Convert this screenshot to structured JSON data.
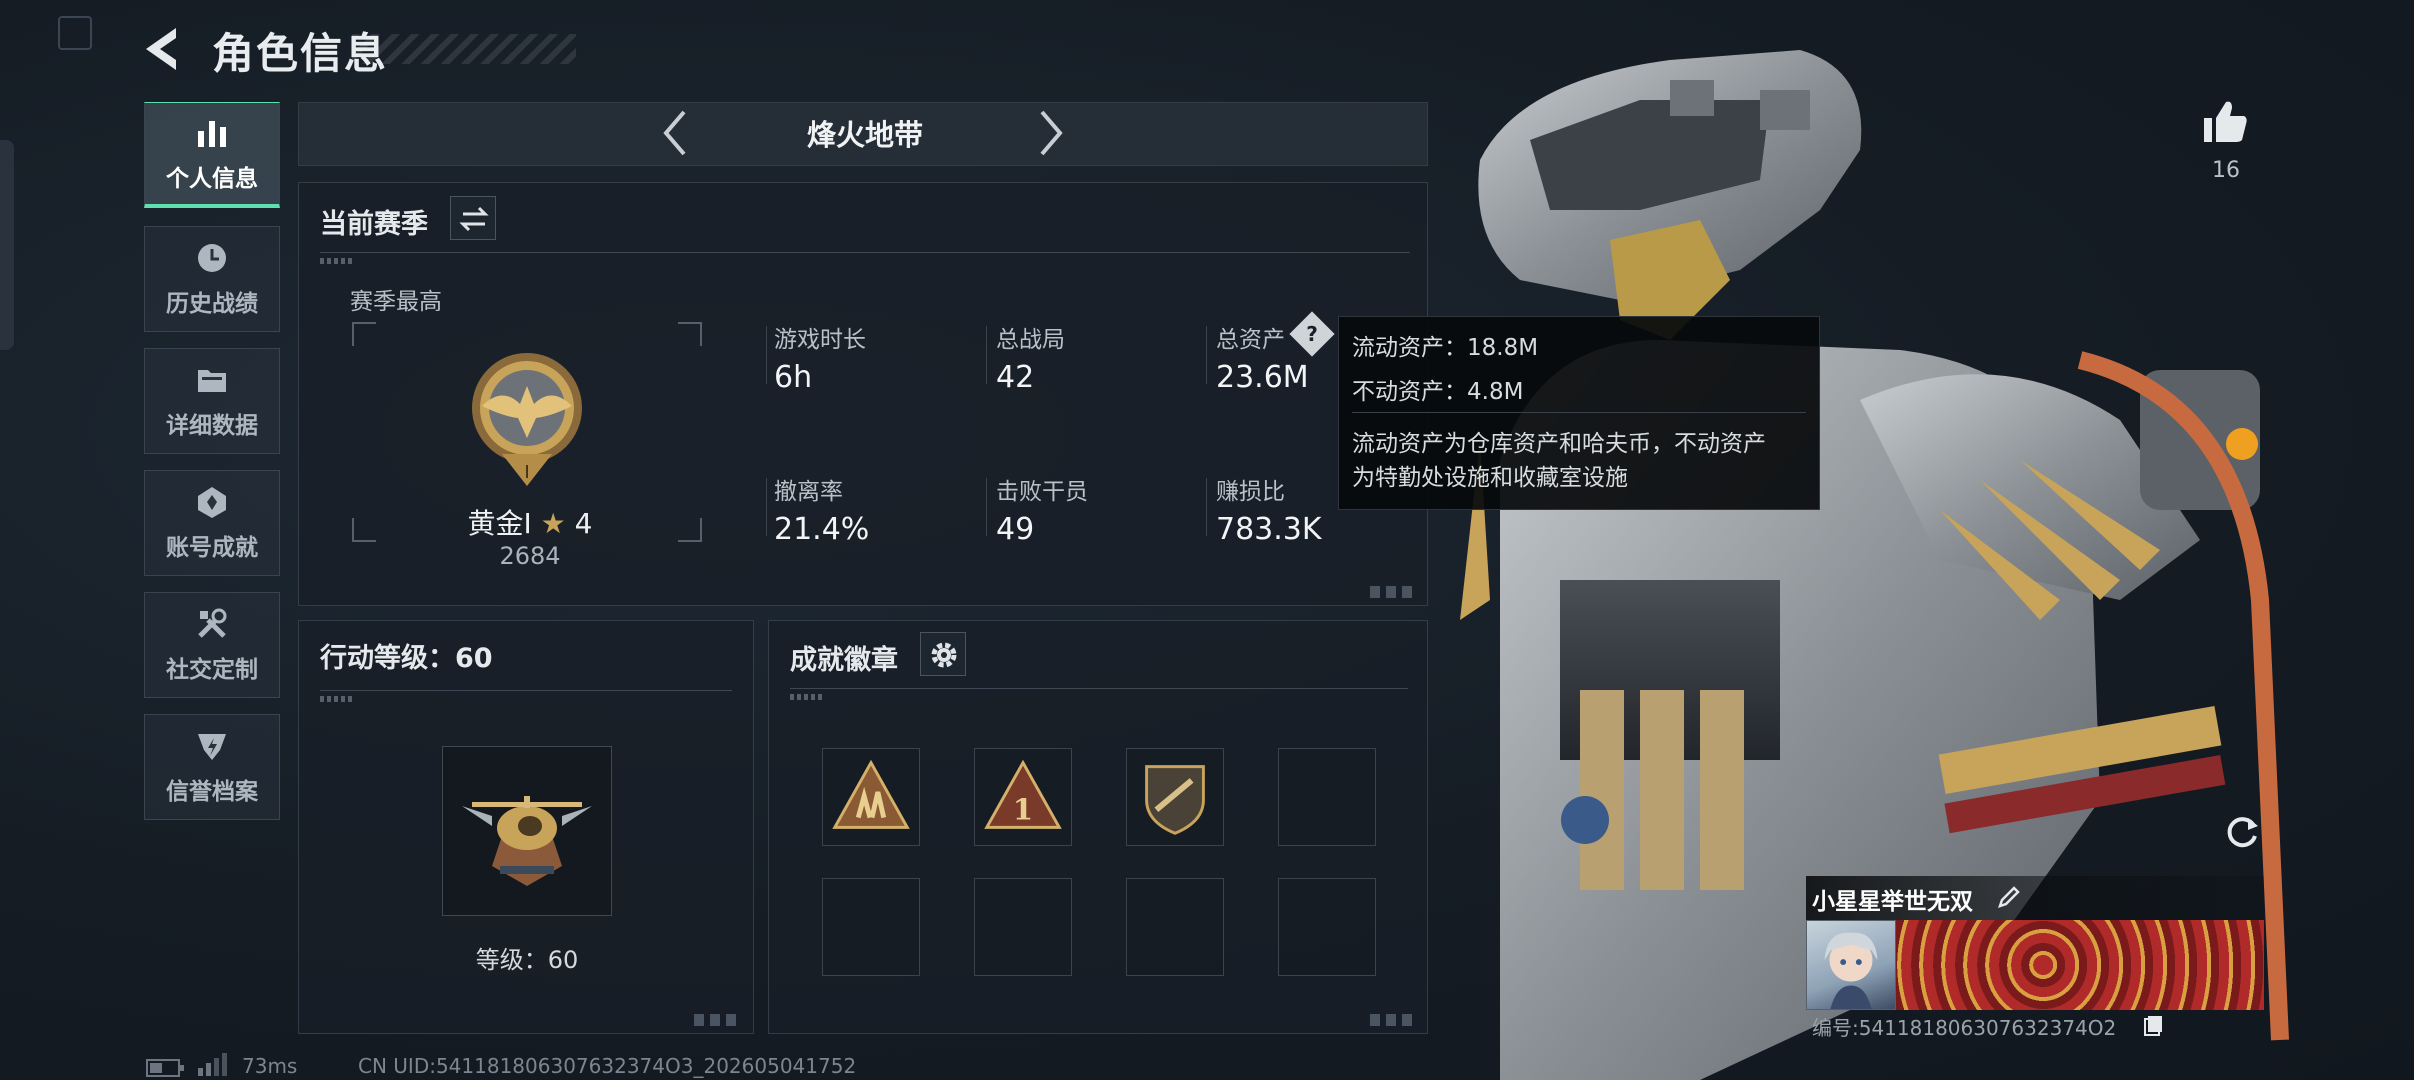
{
  "header": {
    "title": "角色信息"
  },
  "nav": [
    {
      "label": "个人信息",
      "icon": "bar-chart-icon",
      "active": true
    },
    {
      "label": "历史战绩",
      "icon": "clock-icon",
      "active": false
    },
    {
      "label": "详细数据",
      "icon": "folder-icon",
      "active": false
    },
    {
      "label": "账号成就",
      "icon": "achievement-icon",
      "active": false
    },
    {
      "label": "社交定制",
      "icon": "tools-icon",
      "active": false
    },
    {
      "label": "信誉档案",
      "icon": "shield-emblem-icon",
      "active": false
    }
  ],
  "mode": {
    "name": "烽火地带"
  },
  "season": {
    "title": "当前赛季",
    "best_label": "赛季最高",
    "rank": "黄金I",
    "stars": "4",
    "score": "2684",
    "stats": [
      {
        "label": "游戏时长",
        "value": "6h"
      },
      {
        "label": "总战局",
        "value": "42"
      },
      {
        "label": "总资产",
        "value": "23.6M"
      },
      {
        "label": "撤离率",
        "value": "21.4%"
      },
      {
        "label": "击败干员",
        "value": "49"
      },
      {
        "label": "赚损比",
        "value": "783.3K"
      }
    ]
  },
  "tooltip": {
    "line1": "流动资产：18.8M",
    "line2": "不动资产：4.8M",
    "desc_line1": "流动资产为仓库资产和哈夫币，不动资产",
    "desc_line2": "为特勤处设施和收藏室设施"
  },
  "action_level": {
    "title": "行动等级：60",
    "level_label": "等级：60"
  },
  "achievements": {
    "title": "成就徽章"
  },
  "likes": {
    "count": "16"
  },
  "profile": {
    "name": "小星星举世无双",
    "id_text": "编号:541181806307632374O2"
  },
  "footer": {
    "ping": "73ms",
    "uid": "CN UID:541181806307632374O3_202605041752"
  },
  "colors": {
    "accent": "#5fe0b0",
    "panel": "#181f27",
    "gold": "#c8a35a"
  }
}
